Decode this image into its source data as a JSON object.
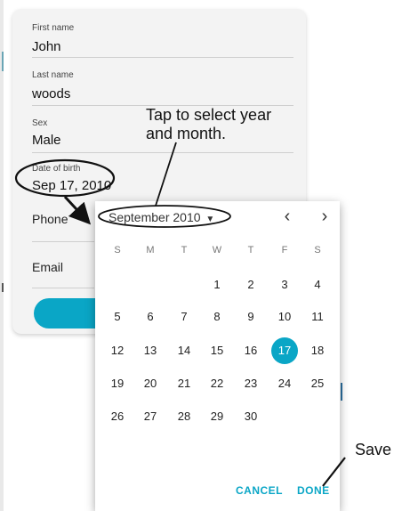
{
  "form": {
    "first_name": {
      "label": "First name",
      "value": "John"
    },
    "last_name": {
      "label": "Last name",
      "value": "woods"
    },
    "sex": {
      "label": "Sex",
      "value": "Male"
    },
    "dob": {
      "label": "Date of birth",
      "value": "Sep 17, 2010"
    },
    "phone_label": "Phone",
    "email_label": "Email"
  },
  "picker": {
    "month_year": "September 2010",
    "dropdown_icon": "triangle-down-icon",
    "prev_icon": "chevron-left-icon",
    "next_icon": "chevron-right-icon",
    "weekdays": [
      "S",
      "M",
      "T",
      "W",
      "T",
      "F",
      "S"
    ],
    "weeks": [
      [
        "",
        "",
        "",
        "1",
        "2",
        "3",
        "4"
      ],
      [
        "5",
        "6",
        "7",
        "8",
        "9",
        "10",
        "11"
      ],
      [
        "12",
        "13",
        "14",
        "15",
        "16",
        "17",
        "18"
      ],
      [
        "19",
        "20",
        "21",
        "22",
        "23",
        "24",
        "25"
      ],
      [
        "26",
        "27",
        "28",
        "29",
        "30",
        "",
        ""
      ]
    ],
    "selected_day": "17",
    "cancel_label": "CANCEL",
    "done_label": "DONE"
  },
  "annotations": {
    "tap_hint_line1": "Tap to select year",
    "tap_hint_line2": "and month.",
    "save_hint": "Save"
  },
  "colors": {
    "accent": "#0aa6c6",
    "card_bg": "#f3f3f3"
  }
}
